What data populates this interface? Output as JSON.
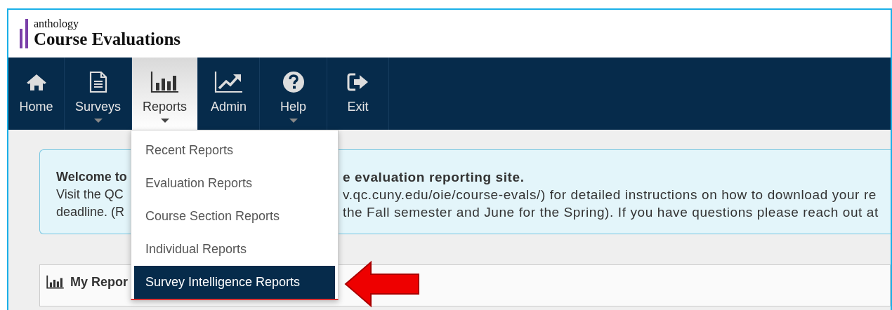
{
  "logo": {
    "brand": "anthology",
    "product": "Course Evaluations"
  },
  "nav": [
    {
      "label": "Home",
      "kind": "home",
      "selected": false,
      "dropdown": false
    },
    {
      "label": "Surveys",
      "kind": "document",
      "selected": false,
      "dropdown": true
    },
    {
      "label": "Reports",
      "kind": "bars",
      "selected": true,
      "dropdown": true
    },
    {
      "label": "Admin",
      "kind": "trend",
      "selected": false,
      "dropdown": false
    },
    {
      "label": "Help",
      "kind": "help",
      "selected": false,
      "dropdown": true
    },
    {
      "label": "Exit",
      "kind": "exit",
      "selected": false,
      "dropdown": false
    }
  ],
  "menu": [
    {
      "label": "Recent Reports",
      "selected": false
    },
    {
      "label": "Evaluation Reports",
      "selected": false
    },
    {
      "label": "Course Section Reports",
      "selected": false
    },
    {
      "label": "Individual Reports",
      "selected": false
    },
    {
      "label": "Survey Intelligence Reports",
      "selected": true
    }
  ],
  "banner": {
    "left": [
      "Welcome to",
      "Visit the QC",
      "deadline. (R"
    ],
    "right": [
      "e evaluation reporting site.",
      "v.qc.cuny.edu/oie/course-evals/) for detailed instructions on how to download your re",
      "the Fall semester and June for the Spring). If you have questions please reach out at"
    ]
  },
  "panel": {
    "title": "My Repor"
  }
}
